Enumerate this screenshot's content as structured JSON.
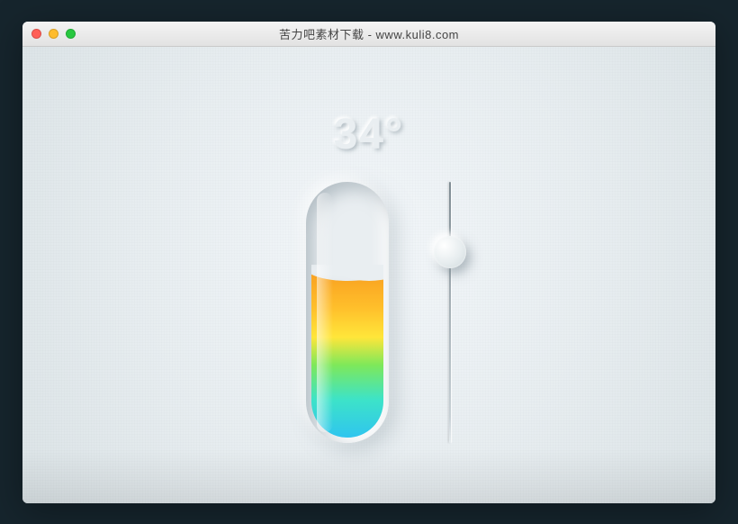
{
  "window": {
    "title": "苦力吧素材下载 - www.kuli8.com",
    "traffic_lights": {
      "close": "close",
      "minimize": "minimize",
      "zoom": "zoom"
    }
  },
  "temperature": {
    "value": 34,
    "display": "34°",
    "unit": "°"
  },
  "tube": {
    "fill_percent": 66
  },
  "slider": {
    "position_percent": 27
  },
  "colors": {
    "bg": "#e9eef1",
    "liquid_stops": [
      "#2fc5ef",
      "#3de3c8",
      "#7ee85a",
      "#ffe63a",
      "#ffbf2b",
      "#f79a1f"
    ]
  }
}
